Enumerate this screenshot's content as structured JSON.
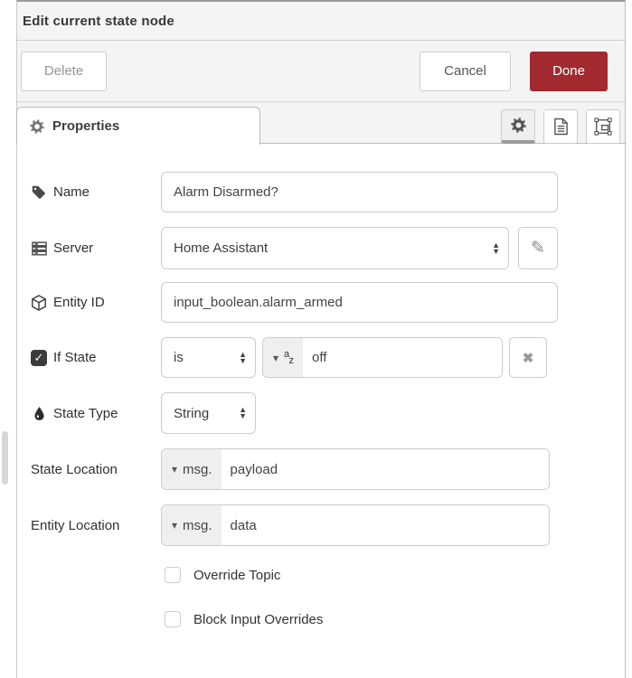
{
  "dialog": {
    "title": "Edit current state node",
    "delete_label": "Delete",
    "cancel_label": "Cancel",
    "done_label": "Done",
    "accent_color": "#a02a2e"
  },
  "tabs": {
    "properties_label": "Properties"
  },
  "form": {
    "name": {
      "label": "Name",
      "value": "Alarm Disarmed?"
    },
    "server": {
      "label": "Server",
      "value": "Home Assistant"
    },
    "entity_id": {
      "label": "Entity ID",
      "value": "input_boolean.alarm_armed"
    },
    "if_state": {
      "label": "If State",
      "checked": true,
      "operator": "is",
      "value": "off"
    },
    "state_type": {
      "label": "State Type",
      "value": "String"
    },
    "state_location": {
      "label": "State Location",
      "prefix": "msg.",
      "value": "payload"
    },
    "entity_location": {
      "label": "Entity Location",
      "prefix": "msg.",
      "value": "data"
    },
    "override_topic": {
      "label": "Override Topic",
      "checked": false
    },
    "block_input_overrides": {
      "label": "Block Input Overrides",
      "checked": false
    }
  },
  "icons": {
    "check": "✓",
    "clear": "✖",
    "pencil": "✎",
    "caret_down": "▾",
    "sort_up": "▲",
    "sort_down": "▼",
    "az_top": "a",
    "az_bottom": "z"
  }
}
